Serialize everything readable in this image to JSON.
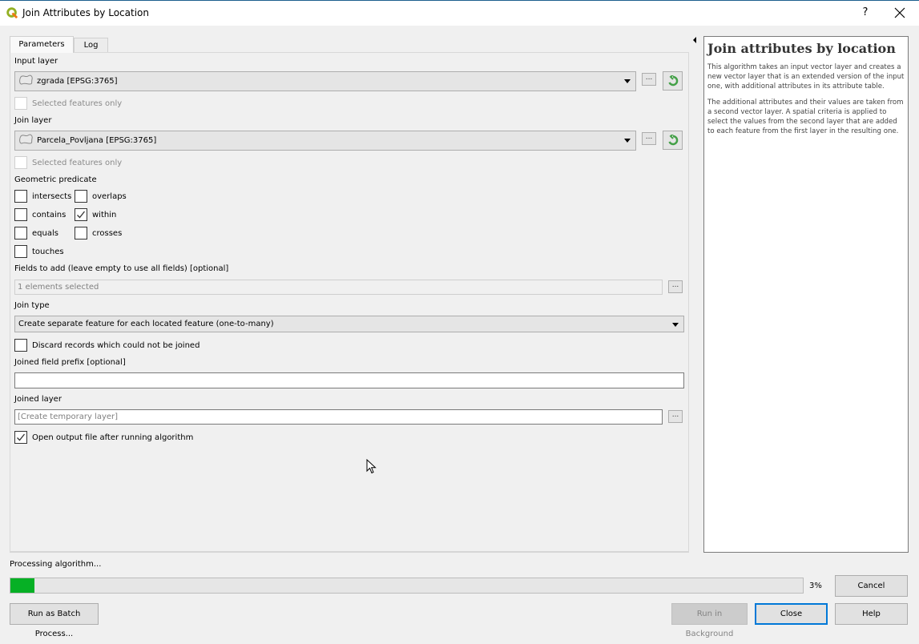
{
  "window": {
    "title": "Join Attributes by Location",
    "help_label": "?",
    "app_icon": "qgis-logo-icon",
    "close_icon": "close-icon"
  },
  "tabs": [
    {
      "label": "Parameters",
      "active": true
    },
    {
      "label": "Log",
      "active": false
    }
  ],
  "parameters": {
    "input_layer": {
      "label": "Input layer",
      "value": "zgrada [EPSG:3765]",
      "selected_only_label": "Selected features only",
      "selected_only_checked": false
    },
    "join_layer": {
      "label": "Join layer",
      "value": "Parcela_Povljana [EPSG:3765]",
      "selected_only_label": "Selected features only",
      "selected_only_checked": false
    },
    "geometric_predicate": {
      "label": "Geometric predicate",
      "options": [
        {
          "label": "intersects",
          "checked": false
        },
        {
          "label": "overlaps",
          "checked": false
        },
        {
          "label": "contains",
          "checked": false
        },
        {
          "label": "within",
          "checked": true
        },
        {
          "label": "equals",
          "checked": false
        },
        {
          "label": "crosses",
          "checked": false
        },
        {
          "label": "touches",
          "checked": false
        }
      ]
    },
    "fields_to_add": {
      "label": "Fields to add (leave empty to use all fields) [optional]",
      "value": "1 elements selected"
    },
    "join_type": {
      "label": "Join type",
      "value": "Create separate feature for each located feature (one-to-many)"
    },
    "discard": {
      "label": "Discard records which could not be joined",
      "checked": false
    },
    "prefix": {
      "label": "Joined field prefix [optional]",
      "value": ""
    },
    "joined_layer": {
      "label": "Joined layer",
      "placeholder": "[Create temporary layer]"
    },
    "open_output": {
      "label": "Open output file after running algorithm",
      "checked": true
    },
    "more_button": "..."
  },
  "help": {
    "title": "Join attributes by location",
    "paragraphs": [
      "This algorithm takes an input vector layer and creates a new vector layer that is an extended version of the input one, with additional attributes in its attribute table.",
      "The additional attributes and their values are taken from a second vector layer. A spatial criteria is applied to select the values from the second layer that are added to each feature from the first layer in the resulting one."
    ]
  },
  "progress": {
    "status": "Processing algorithm...",
    "percent": 3,
    "percent_label": "3%",
    "color": "#06b025"
  },
  "buttons": {
    "batch": "Run as Batch Process...",
    "background": "Run in Background",
    "close": "Close",
    "cancel": "Cancel",
    "help": "Help"
  }
}
